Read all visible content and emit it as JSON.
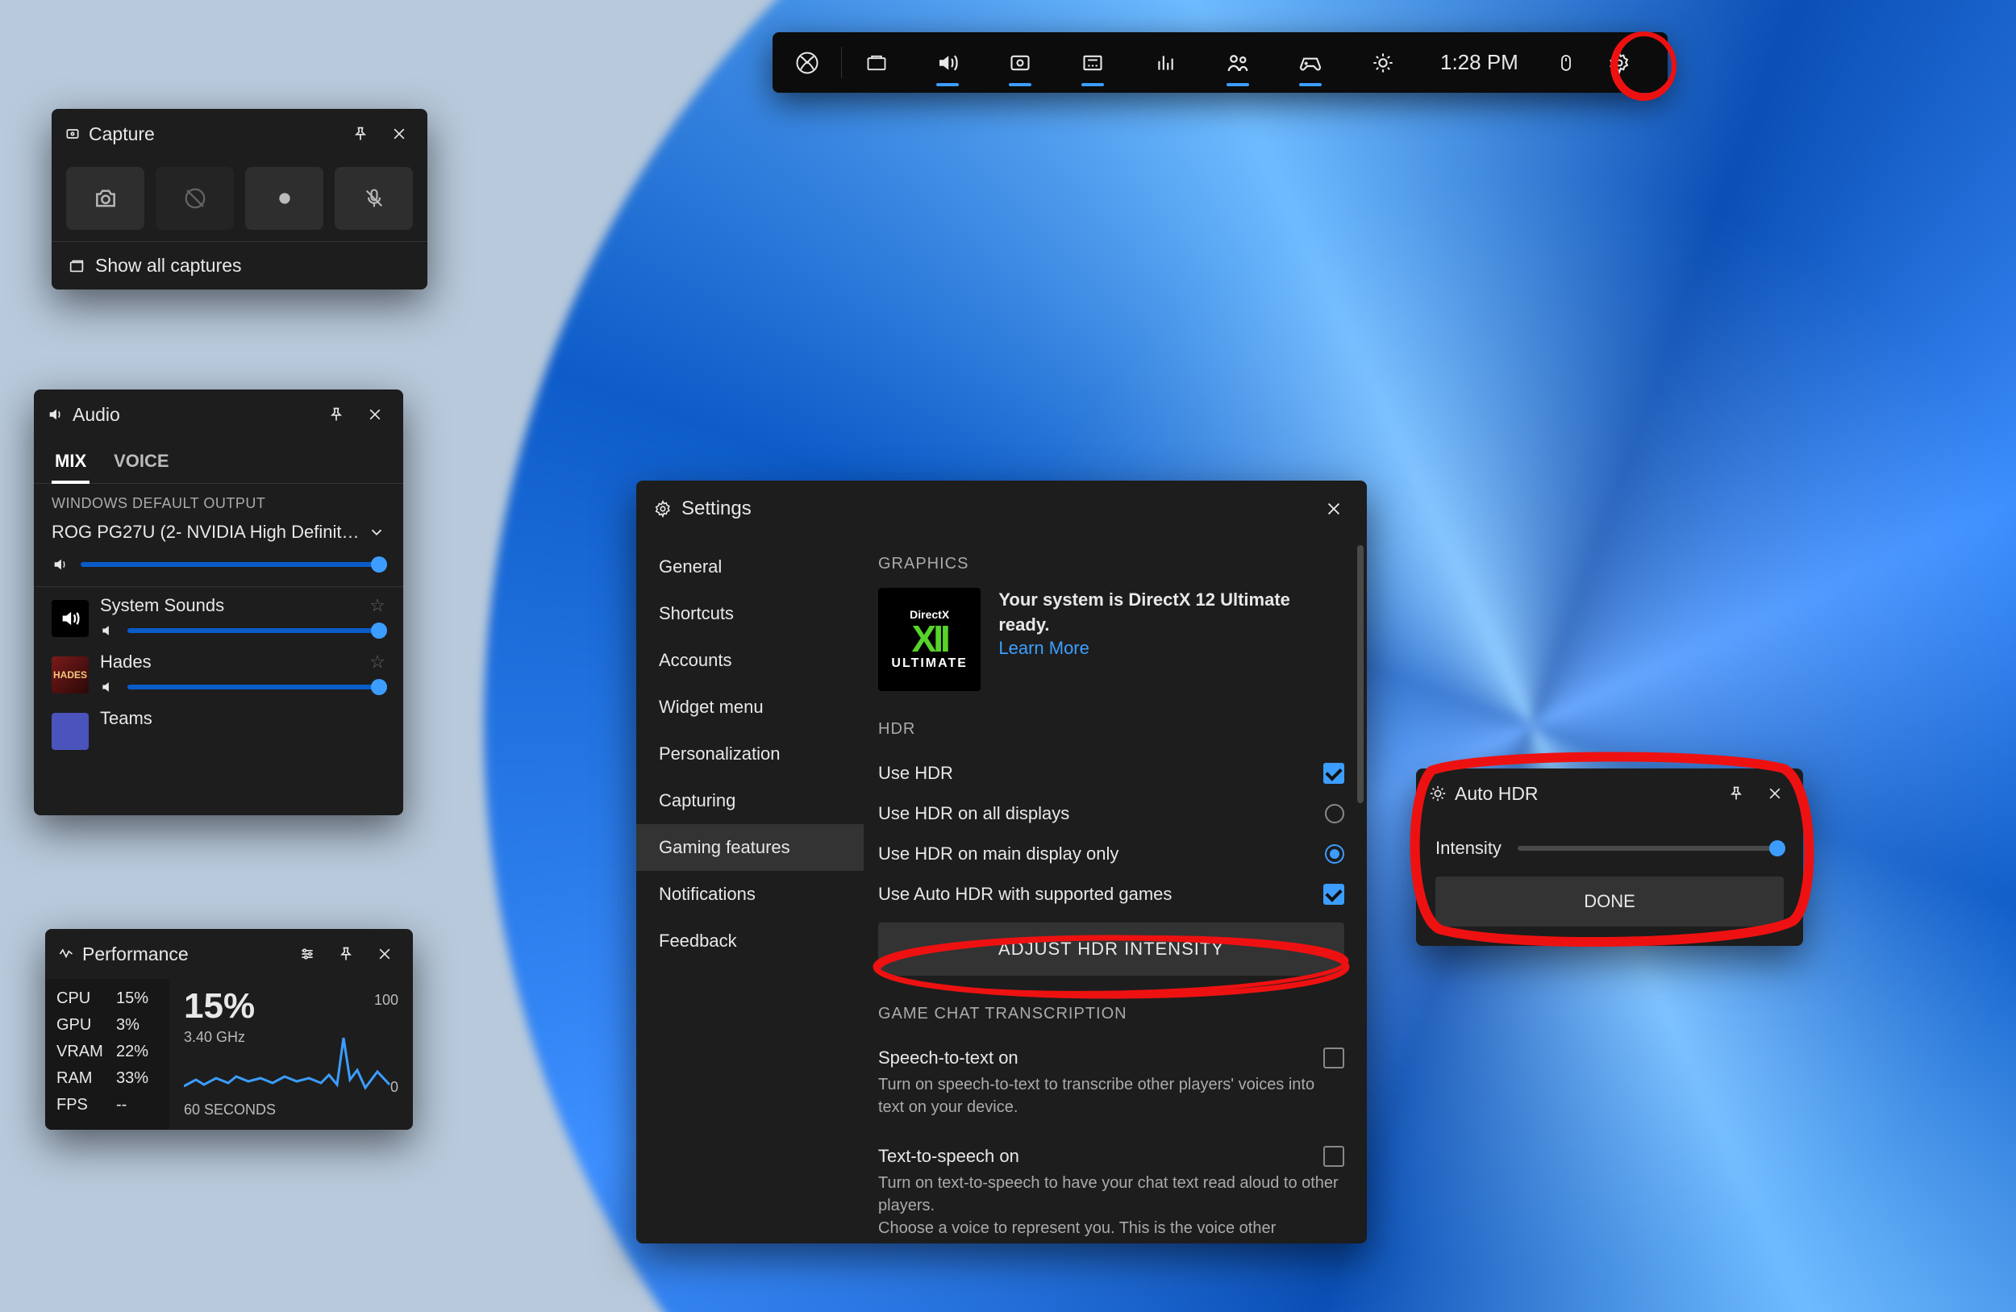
{
  "gamebar": {
    "time": "1:28 PM",
    "icons": [
      {
        "name": "xbox-icon",
        "active": false
      },
      {
        "name": "widgets-icon",
        "active": false
      },
      {
        "name": "audio-icon",
        "active": true
      },
      {
        "name": "capture-icon",
        "active": true
      },
      {
        "name": "performance-icon",
        "active": true
      },
      {
        "name": "resources-icon",
        "active": false
      },
      {
        "name": "social-icon",
        "active": true
      },
      {
        "name": "controller-icon",
        "active": true
      },
      {
        "name": "brightness-icon",
        "active": false
      }
    ],
    "right": [
      {
        "name": "mouse-icon"
      },
      {
        "name": "settings-icon"
      }
    ]
  },
  "capture": {
    "title": "Capture",
    "buttons": [
      "screenshot",
      "record-last",
      "record",
      "mic-off"
    ],
    "show_all": "Show all captures"
  },
  "audio": {
    "title": "Audio",
    "tabs": [
      "MIX",
      "VOICE"
    ],
    "active_tab": 0,
    "default_label": "WINDOWS DEFAULT OUTPUT",
    "device": "ROG PG27U (2- NVIDIA High Definition A...",
    "apps": [
      {
        "name": "System Sounds",
        "icon": "speaker"
      },
      {
        "name": "Hades",
        "icon": "hades"
      },
      {
        "name": "Teams",
        "icon": "teams"
      }
    ]
  },
  "performance": {
    "title": "Performance",
    "stats": [
      {
        "label": "CPU",
        "value": "15%"
      },
      {
        "label": "GPU",
        "value": "3%"
      },
      {
        "label": "VRAM",
        "value": "22%"
      },
      {
        "label": "RAM",
        "value": "33%"
      },
      {
        "label": "FPS",
        "value": "--"
      }
    ],
    "big": "15%",
    "freq": "3.40 GHz",
    "ymax": "100",
    "ymin": "0",
    "xlabel": "60 SECONDS"
  },
  "settings": {
    "title": "Settings",
    "nav": [
      "General",
      "Shortcuts",
      "Accounts",
      "Widget menu",
      "Personalization",
      "Capturing",
      "Gaming features",
      "Notifications",
      "Feedback"
    ],
    "active_nav": 6,
    "graphics_h": "GRAPHICS",
    "dx_line": "Your system is DirectX 12 Ultimate ready.",
    "dx_learn": "Learn More",
    "dx_badge": {
      "top": "DirectX",
      "mid": "XII",
      "bot": "ULTIMATE"
    },
    "hdr_h": "HDR",
    "hdr_opts": [
      {
        "label": "Use HDR",
        "type": "check",
        "checked": true
      },
      {
        "label": "Use HDR on all displays",
        "type": "radio",
        "checked": false
      },
      {
        "label": "Use HDR on main display only",
        "type": "radio",
        "checked": true
      },
      {
        "label": "Use Auto HDR with supported games",
        "type": "check",
        "checked": true
      }
    ],
    "adjust_btn": "ADJUST HDR INTENSITY",
    "chat_h": "GAME CHAT TRANSCRIPTION",
    "chat_opts": [
      {
        "label": "Speech-to-text on",
        "desc": "Turn on speech-to-text to transcribe other players' voices into text on your device.",
        "checked": false
      },
      {
        "label": "Text-to-speech on",
        "desc": "Turn on text-to-speech to have your chat text read aloud to other players.\nChoose a voice to represent you. This is the voice other",
        "checked": false
      }
    ]
  },
  "autohdr": {
    "title": "Auto HDR",
    "intensity": "Intensity",
    "done": "DONE"
  }
}
